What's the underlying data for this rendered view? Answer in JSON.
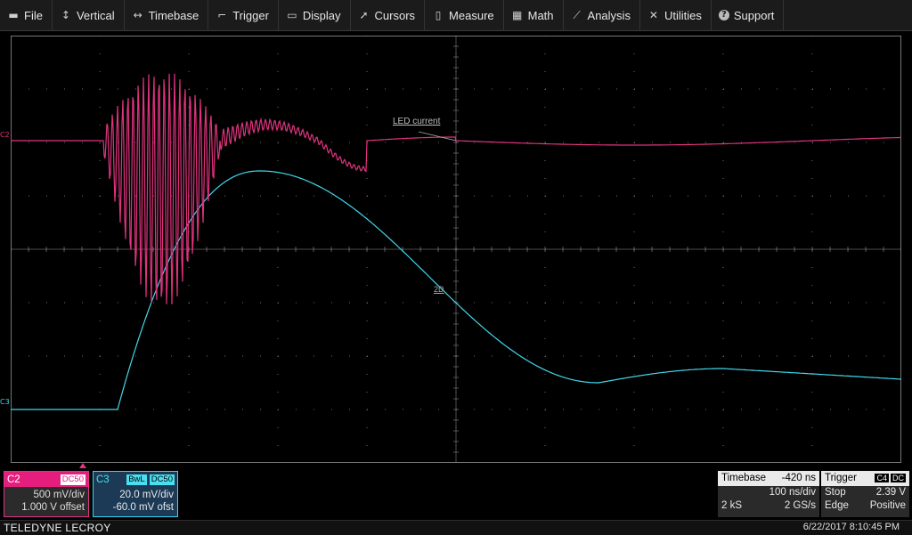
{
  "menu": [
    {
      "label": "File",
      "icon": "file-icon"
    },
    {
      "label": "Vertical",
      "icon": "vertical-arrows-icon"
    },
    {
      "label": "Timebase",
      "icon": "horizontal-arrows-icon"
    },
    {
      "label": "Trigger",
      "icon": "trigger-icon"
    },
    {
      "label": "Display",
      "icon": "display-icon"
    },
    {
      "label": "Cursors",
      "icon": "cursor-icon"
    },
    {
      "label": "Measure",
      "icon": "measure-icon"
    },
    {
      "label": "Math",
      "icon": "calculator-icon"
    },
    {
      "label": "Analysis",
      "icon": "analysis-icon"
    },
    {
      "label": "Utilities",
      "icon": "tools-icon"
    },
    {
      "label": "Support",
      "icon": "help-icon"
    }
  ],
  "waveform": {
    "annotation": "LED current",
    "c2_label": "C2",
    "c3_label": "C3",
    "c3_marker": "2D",
    "colors": {
      "c2": "#e0337f",
      "c3": "#43d7ea",
      "grid": "#8a8a8a"
    }
  },
  "channels": {
    "c2": {
      "name": "C2",
      "coupling": "DC50",
      "scale": "500 mV/div",
      "offset": "1.000 V offset"
    },
    "c3": {
      "name": "C3",
      "bw": "BwL",
      "coupling": "DC50",
      "scale": "20.0 mV/div",
      "offset": "-60.0 mV ofst"
    }
  },
  "timebase": {
    "title": "Timebase",
    "delay": "-420 ns",
    "scale": "100 ns/div",
    "samples": "2 kS",
    "rate": "2 GS/s"
  },
  "trigger": {
    "title": "Trigger",
    "source": "C4",
    "coupling": "DC",
    "mode": "Stop",
    "level": "2.39 V",
    "type": "Edge",
    "slope": "Positive"
  },
  "status": {
    "brand": "TELEDYNE LECROY",
    "datetime": "6/22/2017 8:10:45 PM"
  }
}
